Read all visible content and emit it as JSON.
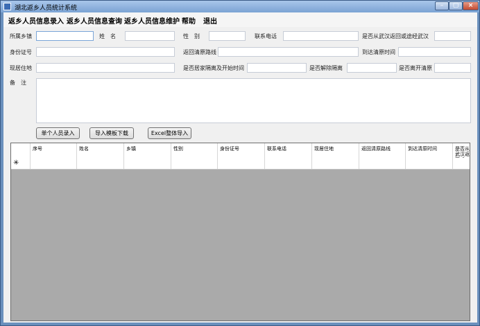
{
  "window": {
    "title": "湖北返乡人员统计系统",
    "min_glyph": "–",
    "max_glyph": "▢",
    "close_glyph": "×"
  },
  "menu": [
    "返乡人员信息录入",
    "返乡人员信息查询",
    "返乡人员信息维护",
    "帮助",
    "退出"
  ],
  "form": {
    "hometown": {
      "label": "所属乡镇",
      "value": ""
    },
    "name": {
      "label": "姓　名",
      "value": ""
    },
    "gender": {
      "label": "性　别",
      "value": ""
    },
    "phone": {
      "label": "联系电话",
      "value": ""
    },
    "from_wuhan": {
      "label": "是否从武汉返回或途经武汉",
      "value": ""
    },
    "id_number": {
      "label": "身份证号",
      "value": ""
    },
    "return_route": {
      "label": "返回清原路线",
      "value": ""
    },
    "arrival_time": {
      "label": "到达清原时间",
      "value": ""
    },
    "current_address": {
      "label": "现居住地",
      "value": ""
    },
    "home_quarantine": {
      "label": "是否居家隔离及开始时间",
      "value": ""
    },
    "quarantine_lifted": {
      "label": "是否解除隔离",
      "value": ""
    },
    "left_qingyuan": {
      "label": "是否离开清原",
      "value": ""
    },
    "notes": {
      "label": "备　注",
      "value": ""
    }
  },
  "buttons": {
    "single_entry": "单个人员录入",
    "import_template": "导入模板下载",
    "excel_import": "Excel整体导入"
  },
  "grid": {
    "columns": [
      "序号",
      "姓名",
      "乡镇",
      "性别",
      "身份证号",
      "联系电话",
      "现居住地",
      "返回清原路线",
      "到达清原时间",
      "是否从武汉返回或"
    ],
    "new_row_icon": "✳"
  }
}
